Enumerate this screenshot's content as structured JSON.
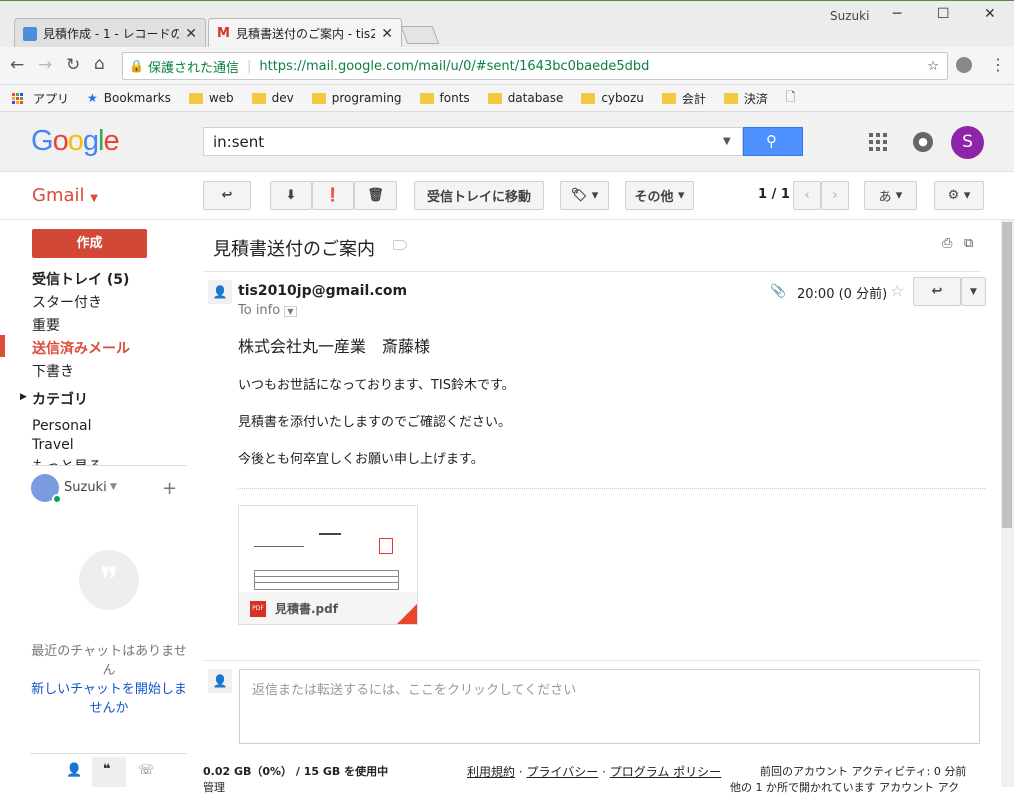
{
  "browser": {
    "user_name": "Suzuki",
    "tabs": [
      {
        "label": "見積作成 - 1 - レコードの詳"
      },
      {
        "label": "見積書送付のご案内 - tis2"
      }
    ],
    "address_secure": "保護された通信",
    "address_url": "https://mail.google.com/mail/u/0/#sent/1643bc0baede5dbd",
    "bookmarks": [
      "アプリ",
      "Bookmarks",
      "web",
      "dev",
      "programing",
      "fonts",
      "database",
      "cybozu",
      "会計",
      "決済"
    ]
  },
  "gmail": {
    "logo": "Google",
    "search_value": "in:sent",
    "avatar_initial": "S",
    "gmail_label": "Gmail",
    "compose": "作成",
    "move_inbox": "受信トレイに移動",
    "more": "その他",
    "pager": "1 / 1",
    "input_tool": "あ",
    "nav": [
      {
        "label": "受信トレイ (5)",
        "bold": true
      },
      {
        "label": "スター付き"
      },
      {
        "label": "重要"
      },
      {
        "label": "送信済みメール",
        "active": true
      },
      {
        "label": "下書き"
      }
    ],
    "categories": "カテゴリ",
    "labels": [
      "Personal",
      "Travel",
      "もっと見る"
    ],
    "chat_user": "Suzuki",
    "chat_empty": "最近のチャットはありません",
    "chat_start": "新しいチャットを開始しませんか"
  },
  "message": {
    "subject": "見積書送付のご案内",
    "sender": "tis2010jp@gmail.com",
    "to": "To info",
    "time": "20:00 (0 分前)",
    "body": [
      "株式会社丸一産業　斎藤様",
      "いつもお世話になっております、TIS鈴木です。",
      "見積書を添付いたしますのでご確認ください。",
      "今後とも何卒宜しくお願い申し上げます。"
    ],
    "attachment_name": "見積書.pdf",
    "attachment_type": "PDF",
    "reply_placeholder": "返信または転送するには、ここをクリックしてください"
  },
  "footer": {
    "storage": "0.02 GB（0%） / 15 GB を使用中",
    "manage": "管理",
    "terms": "利用規約",
    "privacy": "プライバシー",
    "program": "プログラム ポリシー",
    "activity": "前回のアカウント アクティビティ: 0 分前",
    "activity2": "他の 1 か所で開かれています アカウント アク"
  }
}
